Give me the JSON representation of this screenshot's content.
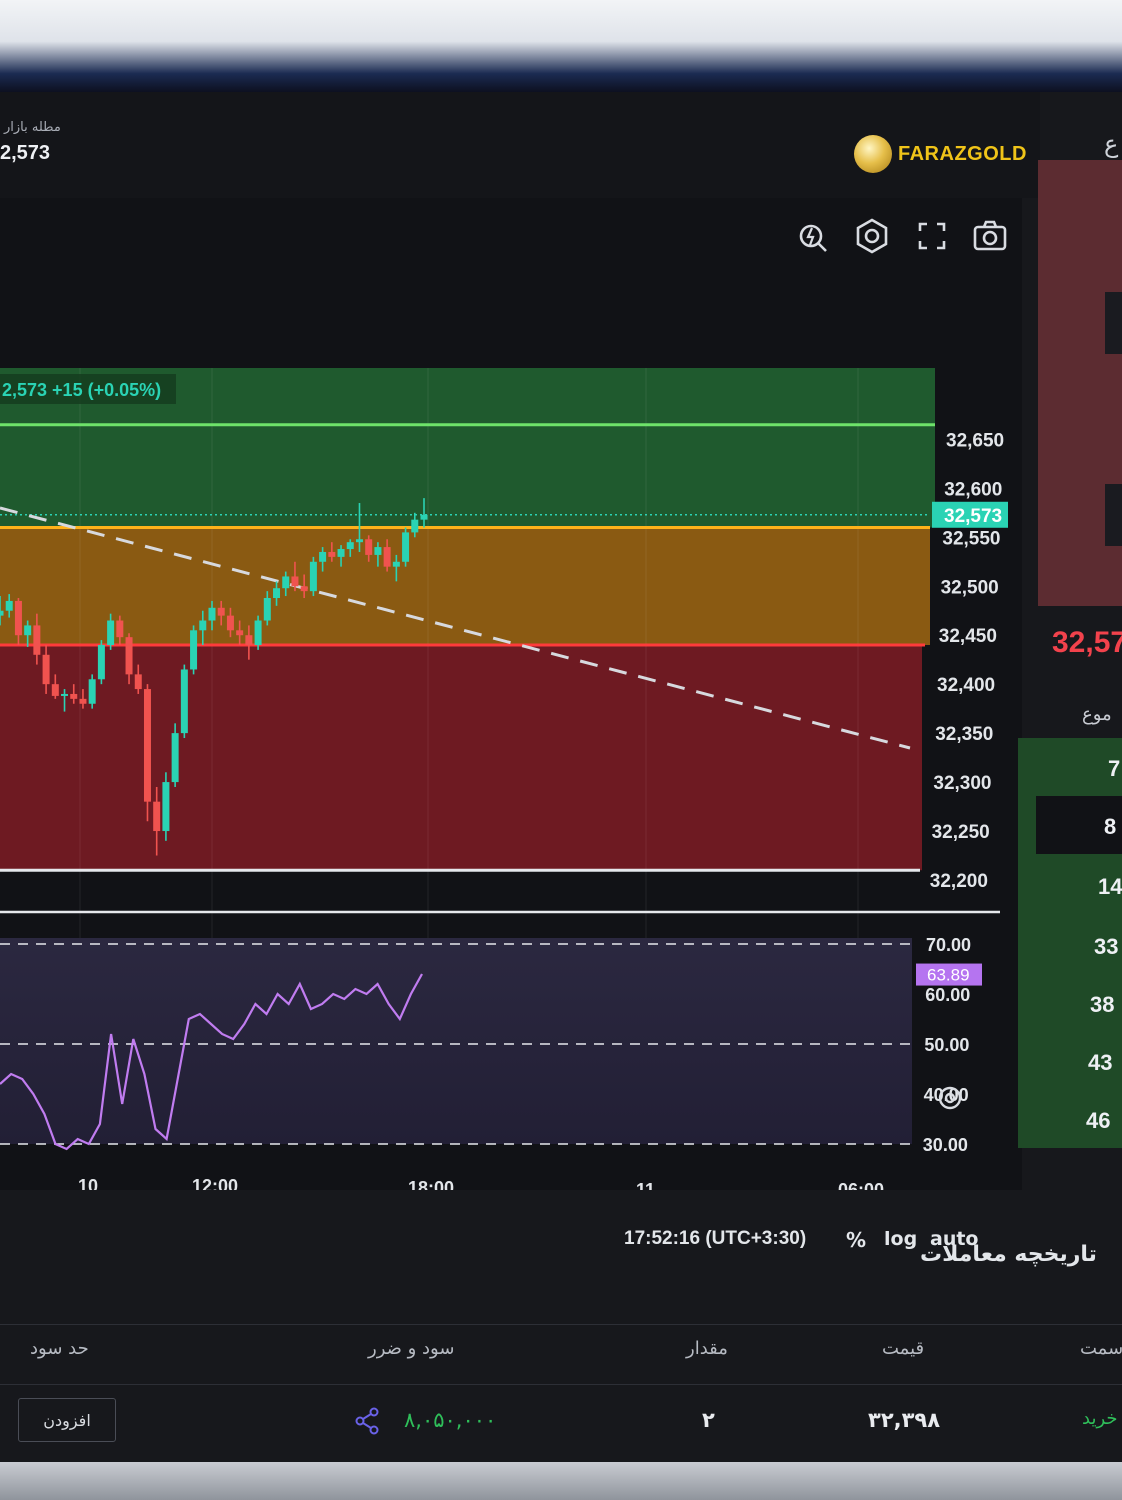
{
  "header": {
    "market_label": "مطله بازار",
    "market_price": "2,573",
    "brand": "FARAZGOLD",
    "right_edge_char": "ع"
  },
  "toolbar": {
    "icons": [
      "indicator-icon",
      "settings-icon",
      "fullscreen-icon",
      "screenshot-icon"
    ]
  },
  "chart": {
    "price_badge": "2,573 +15 (+0.05%)",
    "current_price_tag": "32,573",
    "price_ticks": [
      "32,650",
      "32,600",
      "32,550",
      "32,500",
      "32,450",
      "32,400",
      "32,350",
      "32,300",
      "32,250",
      "32,200"
    ],
    "rsi_tag": "63.89",
    "rsi_ticks": [
      "70.00",
      "60.00",
      "50.00",
      "40.00",
      "30.00"
    ],
    "time_ticks": [
      "10",
      "12:00",
      "18:00",
      "11",
      "06:00"
    ],
    "clock": "17:52:16 (UTC+3:30)",
    "scale_options": [
      "%",
      "log",
      "auto"
    ],
    "colors": {
      "bull": "#2ad3b4",
      "bear": "#f0534f",
      "green_zone": "#1f5a2e",
      "orange_zone": "#8a5a12",
      "red_zone": "#6e1a22",
      "rsi_line": "#c07cf0"
    }
  },
  "chart_data": {
    "type": "candlestick",
    "ylim": [
      32200,
      32680
    ],
    "rsi_ylim": [
      30,
      70
    ],
    "reference_lines": {
      "green": 32665,
      "orange": 32560,
      "red": 32440,
      "white": 32210
    },
    "candles": [
      [
        32470,
        32490,
        32460,
        32475
      ],
      [
        32475,
        32492,
        32468,
        32485
      ],
      [
        32485,
        32488,
        32440,
        32450
      ],
      [
        32450,
        32465,
        32438,
        32460
      ],
      [
        32460,
        32472,
        32420,
        32430
      ],
      [
        32430,
        32440,
        32390,
        32400
      ],
      [
        32400,
        32410,
        32385,
        32388
      ],
      [
        32388,
        32395,
        32372,
        32390
      ],
      [
        32390,
        32400,
        32380,
        32385
      ],
      [
        32385,
        32395,
        32375,
        32380
      ],
      [
        32380,
        32410,
        32375,
        32405
      ],
      [
        32405,
        32445,
        32400,
        32440
      ],
      [
        32440,
        32472,
        32435,
        32465
      ],
      [
        32465,
        32470,
        32440,
        32448
      ],
      [
        32448,
        32452,
        32400,
        32410
      ],
      [
        32410,
        32420,
        32390,
        32395
      ],
      [
        32395,
        32400,
        32260,
        32280
      ],
      [
        32280,
        32295,
        32225,
        32250
      ],
      [
        32250,
        32310,
        32240,
        32300
      ],
      [
        32300,
        32360,
        32295,
        32350
      ],
      [
        32350,
        32420,
        32345,
        32415
      ],
      [
        32415,
        32460,
        32410,
        32455
      ],
      [
        32455,
        32475,
        32440,
        32465
      ],
      [
        32465,
        32485,
        32455,
        32478
      ],
      [
        32478,
        32485,
        32460,
        32470
      ],
      [
        32470,
        32478,
        32448,
        32455
      ],
      [
        32455,
        32465,
        32440,
        32450
      ],
      [
        32450,
        32460,
        32425,
        32440
      ],
      [
        32440,
        32470,
        32435,
        32465
      ],
      [
        32465,
        32495,
        32460,
        32488
      ],
      [
        32488,
        32505,
        32480,
        32498
      ],
      [
        32498,
        32515,
        32490,
        32510
      ],
      [
        32510,
        32525,
        32495,
        32500
      ],
      [
        32500,
        32512,
        32488,
        32495
      ],
      [
        32495,
        32530,
        32490,
        32525
      ],
      [
        32525,
        32540,
        32515,
        32535
      ],
      [
        32535,
        32545,
        32525,
        32530
      ],
      [
        32530,
        32542,
        32520,
        32538
      ],
      [
        32538,
        32548,
        32530,
        32545
      ],
      [
        32545,
        32585,
        32535,
        32548
      ],
      [
        32548,
        32552,
        32525,
        32532
      ],
      [
        32532,
        32545,
        32520,
        32540
      ],
      [
        32540,
        32548,
        32515,
        32520
      ],
      [
        32520,
        32532,
        32505,
        32525
      ],
      [
        32525,
        32560,
        32520,
        32555
      ],
      [
        32555,
        32575,
        32550,
        32568
      ],
      [
        32568,
        32590,
        32560,
        32573
      ]
    ],
    "rsi_values": [
      42,
      44,
      43,
      40,
      36,
      30,
      29,
      31,
      30,
      34,
      52,
      38,
      51,
      44,
      33,
      31,
      43,
      55,
      56,
      54,
      52,
      51,
      54,
      58,
      56,
      60,
      58,
      62,
      57,
      58,
      60,
      59,
      61,
      60,
      62,
      58,
      55,
      60,
      64
    ]
  },
  "orderbook": {
    "mid_price": "32,57",
    "label": "موع",
    "numbers": [
      "7",
      "8",
      "14",
      "33",
      "38",
      "43",
      "46"
    ]
  },
  "history": {
    "title": "تاریخچه معاملات",
    "columns": [
      "حد سود",
      "سود و ضرر",
      "مقدار",
      "قیمت",
      "سمت"
    ],
    "row": {
      "take_profit_button": "افزودن",
      "pnl": "۸,۰۵۰,۰۰۰",
      "amount": "۲",
      "price": "۳۲,۳۹۸",
      "side": "خرید"
    }
  }
}
